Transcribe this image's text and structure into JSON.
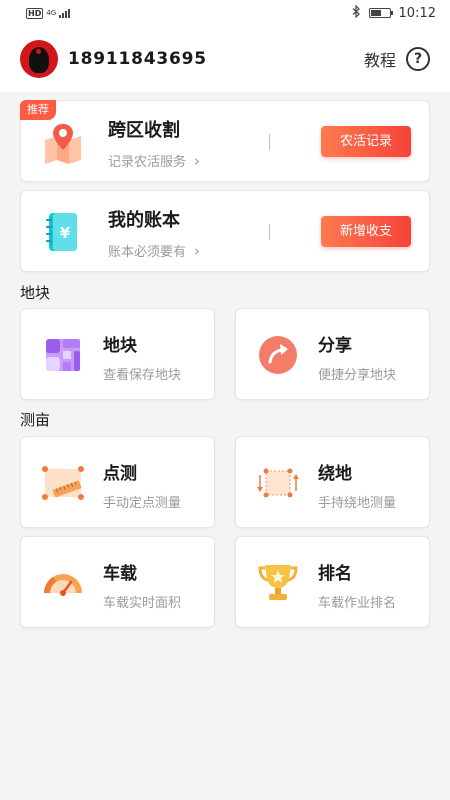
{
  "status_bar": {
    "hd": "HD",
    "network": "4G",
    "time": "10:12",
    "battery_level": 0.6
  },
  "header": {
    "phone": "18911843695",
    "tutorial_label": "教程",
    "help_symbol": "?"
  },
  "cards": [
    {
      "badge": "推荐",
      "title": "跨区收割",
      "subtitle": "记录农活服务",
      "button": "农活记录",
      "icon": "map-pin-icon"
    },
    {
      "title": "我的账本",
      "subtitle": "账本必须要有",
      "button": "新增收支",
      "icon": "ledger-yen-icon"
    }
  ],
  "sections": {
    "plots": {
      "label": "地块",
      "tiles": [
        {
          "title": "地块",
          "subtitle": "查看保存地块",
          "icon": "plot-grid-icon"
        },
        {
          "title": "分享",
          "subtitle": "便捷分享地块",
          "icon": "share-arrow-icon"
        }
      ]
    },
    "measure": {
      "label": "测亩",
      "tiles": [
        {
          "title": "点测",
          "subtitle": "手动定点测量",
          "icon": "ruler-frame-icon"
        },
        {
          "title": "绕地",
          "subtitle": "手持绕地测量",
          "icon": "walk-around-icon"
        },
        {
          "title": "车载",
          "subtitle": "车载实时面积",
          "icon": "speedometer-icon"
        },
        {
          "title": "排名",
          "subtitle": "车载作业排名",
          "icon": "trophy-icon"
        }
      ]
    }
  },
  "colors": {
    "accent_red": "#f5433a",
    "badge_red": "#ff5a44",
    "text_gray": "#9a9a9a"
  }
}
